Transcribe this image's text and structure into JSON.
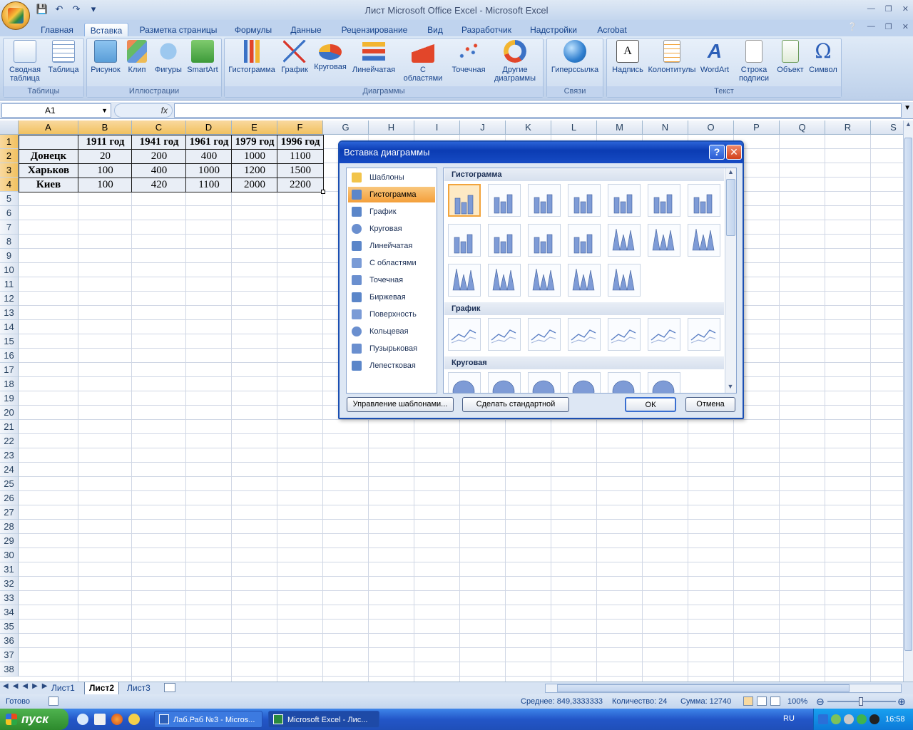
{
  "window": {
    "title": "Лист Microsoft Office Excel - Microsoft Excel"
  },
  "ribbon_tabs": [
    "Главная",
    "Вставка",
    "Разметка страницы",
    "Формулы",
    "Данные",
    "Рецензирование",
    "Вид",
    "Разработчик",
    "Надстройки",
    "Acrobat"
  ],
  "active_tab": "Вставка",
  "ribbon_groups": {
    "tables": {
      "label": "Таблицы",
      "buttons": [
        "Сводная таблица",
        "Таблица"
      ]
    },
    "illustrations": {
      "label": "Иллюстрации",
      "buttons": [
        "Рисунок",
        "Клип",
        "Фигуры",
        "SmartArt"
      ]
    },
    "charts": {
      "label": "Диаграммы",
      "buttons": [
        "Гистограмма",
        "График",
        "Круговая",
        "Линейчатая",
        "С областями",
        "Точечная",
        "Другие диаграммы"
      ]
    },
    "links": {
      "label": "Связи",
      "buttons": [
        "Гиперссылка"
      ]
    },
    "text": {
      "label": "Текст",
      "buttons": [
        "Надпись",
        "Колонтитулы",
        "WordArt",
        "Строка подписи",
        "Объект",
        "Символ"
      ]
    }
  },
  "formula_bar": {
    "name_box": "A1",
    "fx": "fx",
    "value": ""
  },
  "columns": [
    "A",
    "B",
    "C",
    "D",
    "E",
    "F",
    "G",
    "H",
    "I",
    "J",
    "K",
    "L",
    "M",
    "N",
    "O",
    "P",
    "Q",
    "R",
    "S"
  ],
  "rows_count": 38,
  "table": {
    "header": [
      "",
      "1911 год",
      "1941 год",
      "1961 год",
      "1979 год",
      "1996 год"
    ],
    "rows": [
      [
        "Донецк",
        "20",
        "200",
        "400",
        "1000",
        "1100"
      ],
      [
        "Харьков",
        "100",
        "400",
        "1000",
        "1200",
        "1500"
      ],
      [
        "Киев",
        "100",
        "420",
        "1100",
        "2000",
        "2200"
      ]
    ]
  },
  "sheet_tabs": [
    "Лист1",
    "Лист2",
    "Лист3"
  ],
  "active_sheet": "Лист2",
  "status": {
    "ready": "Готово",
    "average": "Среднее: 849,3333333",
    "count": "Количество: 24",
    "sum": "Сумма: 12740",
    "zoom": "100%"
  },
  "dialog": {
    "title": "Вставка диаграммы",
    "categories": [
      "Шаблоны",
      "Гистограмма",
      "График",
      "Круговая",
      "Линейчатая",
      "С областями",
      "Точечная",
      "Биржевая",
      "Поверхность",
      "Кольцевая",
      "Пузырьковая",
      "Лепестковая"
    ],
    "selected_category": "Гистограмма",
    "gallery_sections": [
      "Гистограмма",
      "График",
      "Круговая"
    ],
    "buttons": {
      "manage": "Управление шаблонами...",
      "set_default": "Сделать стандартной",
      "ok": "ОК",
      "cancel": "Отмена"
    }
  },
  "taskbar": {
    "start": "пуск",
    "tasks": [
      "Лаб.Раб №3 - Micros...",
      "Microsoft Excel - Лис..."
    ],
    "lang": "RU",
    "clock": "16:58"
  },
  "colors": {
    "accent": "#2a63d7",
    "selection": "#f2a43c"
  }
}
